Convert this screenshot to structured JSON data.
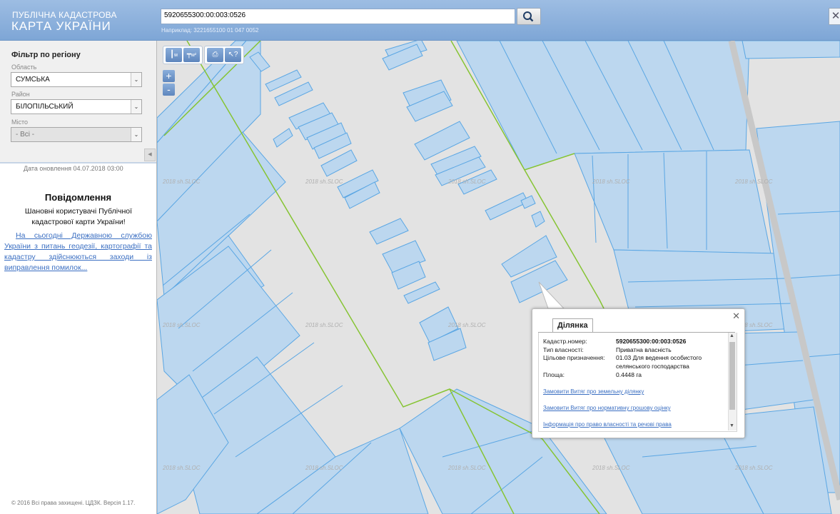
{
  "header": {
    "logo_line1": "ПУБЛІЧНА КАДАСТРОВА",
    "logo_line2": "КАРТА УКРАЇНИ",
    "search_value": "5920655300:00:003:0526",
    "search_hint": "Наприклад: 3221655100 01 047 0052",
    "search_icon": "search-icon",
    "close_icon": "close-icon"
  },
  "sidebar": {
    "filter_title": "Фільтр по регіону",
    "region_label": "Область",
    "region_value": "СУМСЬКА",
    "district_label": "Район",
    "district_value": "БІЛОПІЛЬСЬКИЙ",
    "city_label": "Місто",
    "city_value": "- Всі -",
    "updated": "Дата оновлення  04.07.2018 03:00",
    "message_title": "Повідомлення",
    "message_greeting": "Шановні користувачі Публічної кадастрової карти України!",
    "message_link": "На сьогодні Державною службою України з питань геодезії, картографії та кадастру здійснюються заходи із виправлення помилок...",
    "copyright": "© 2016 Всі права захищені. ЦДЗК. Версія 1.17."
  },
  "toolbar": {
    "ruler_label": "м",
    "area_label": "м²",
    "print_icon": "print-icon",
    "info_icon": "identify-icon",
    "zoom_in": "+",
    "zoom_out": "-"
  },
  "popup": {
    "tab": "Ділянка",
    "fields": [
      {
        "label": "Кадастр.номер:",
        "value": "5920655300:00:003:0526"
      },
      {
        "label": "Тип власності:",
        "value": "Приватна власність"
      },
      {
        "label": "Цільове призначення:",
        "value": "01.03 Для ведення особистого селянського господарства"
      },
      {
        "label": "Площа:",
        "value": "0.4448 га"
      }
    ],
    "links": [
      "Замовити Витяг про земельну ділянку",
      "Замовити Витяг про нормативну грошову оцінку",
      "Інформація про право власності та речові права"
    ]
  },
  "map": {
    "watermark": "2018 sh.SLOC",
    "colors": {
      "parcel_fill": "#bcd7ef",
      "parcel_stroke": "#5aa6e3",
      "boundary": "#86c433",
      "background": "#e3e3e3"
    }
  }
}
